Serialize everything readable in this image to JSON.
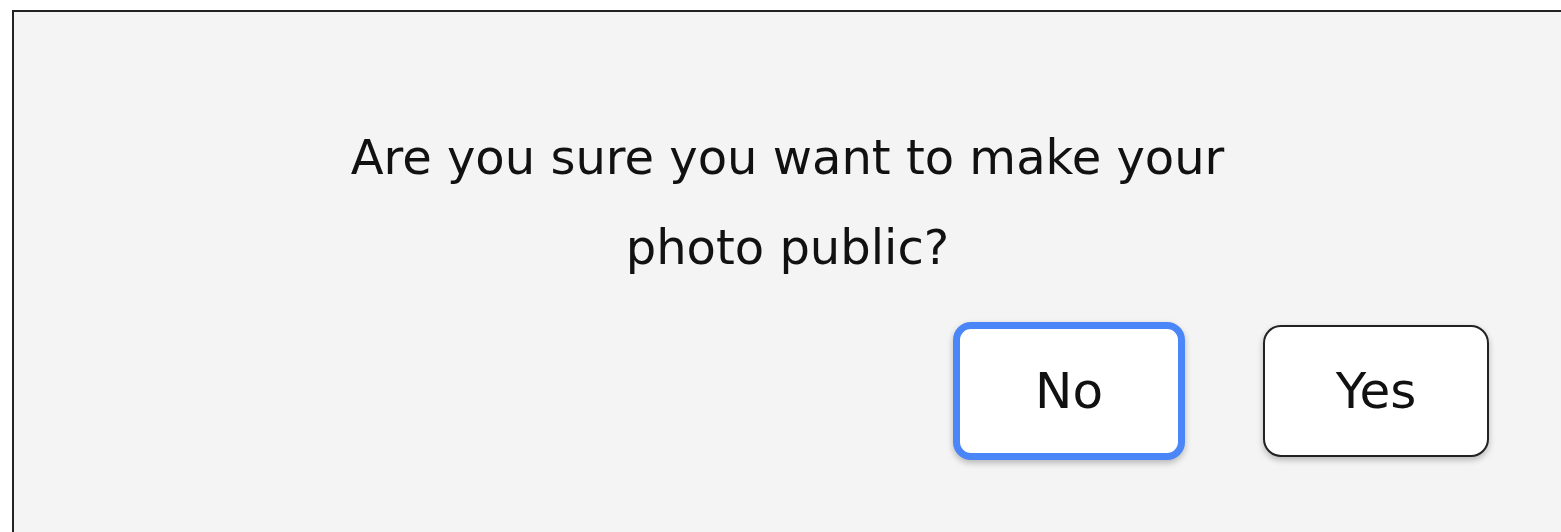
{
  "dialog": {
    "message": "Are you sure you want to make your photo public?",
    "buttons": [
      {
        "label": "No",
        "focused": true
      },
      {
        "label": "Yes",
        "focused": false
      }
    ]
  }
}
